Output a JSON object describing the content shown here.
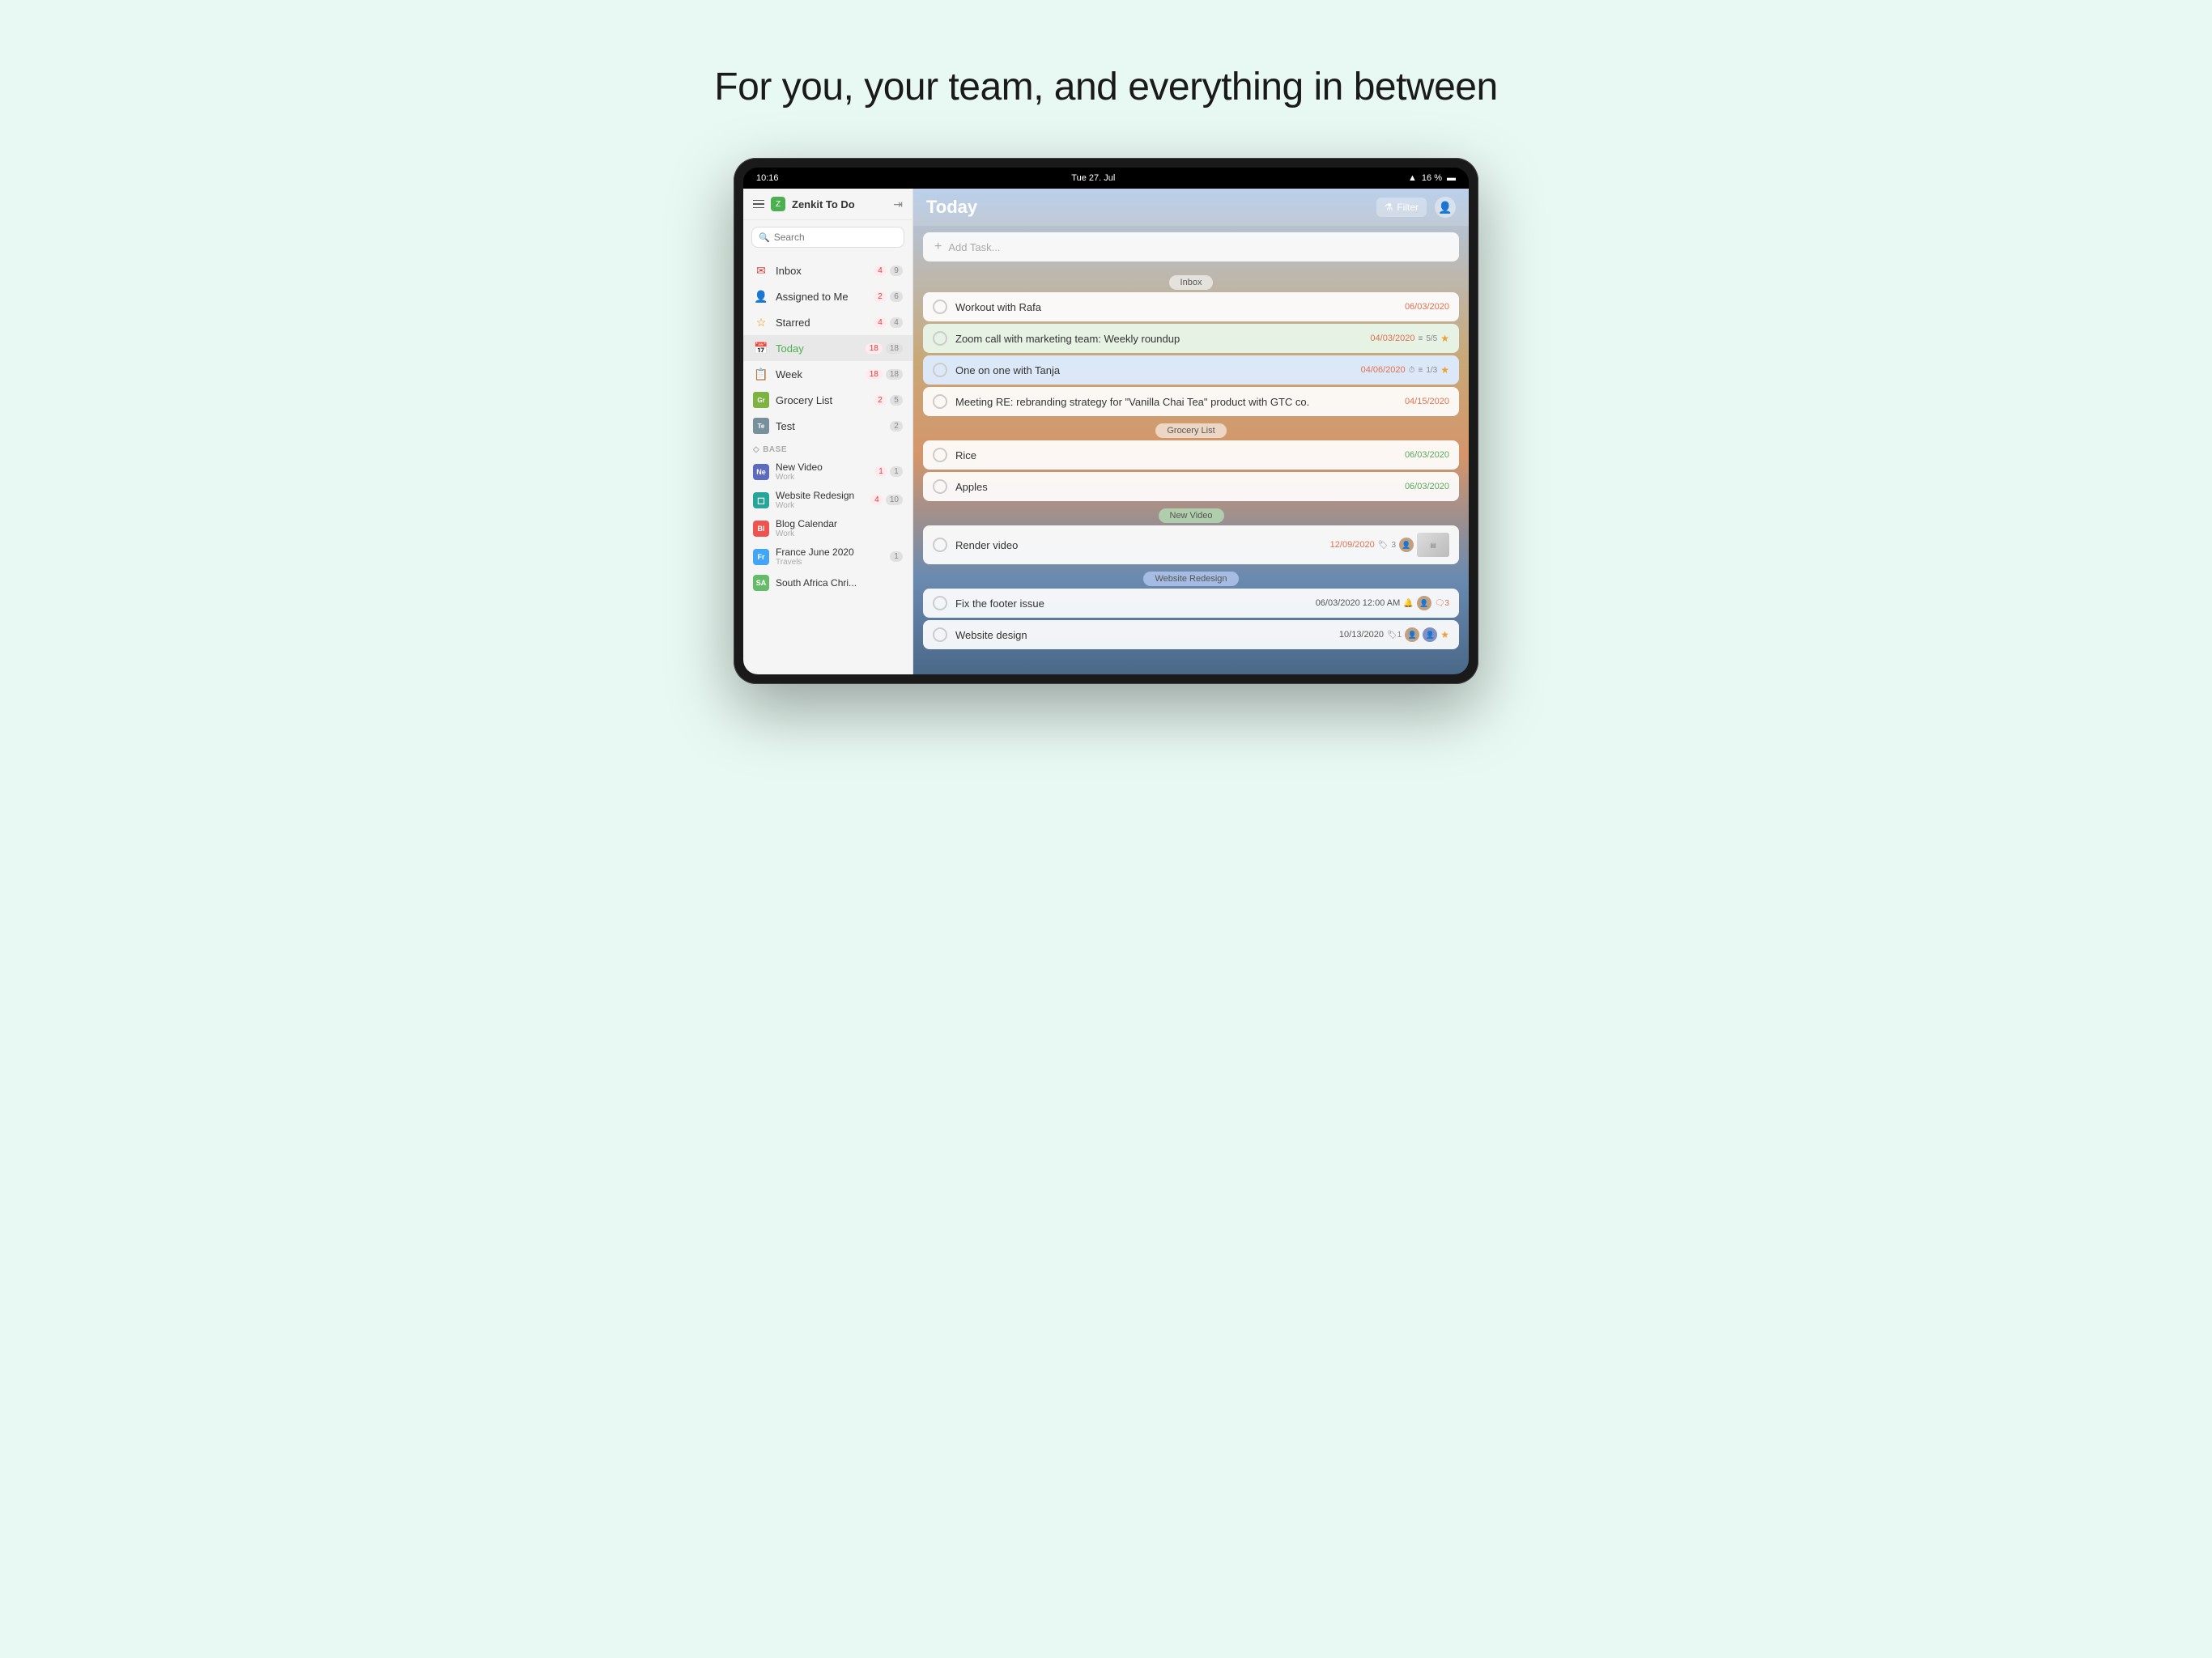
{
  "page": {
    "headline": "For you, your team, and everything in between"
  },
  "statusBar": {
    "time": "10:16",
    "date": "Tue 27. Jul",
    "battery": "16 %"
  },
  "sidebar": {
    "appName": "Zenkit To Do",
    "searchPlaceholder": "Search",
    "navItems": [
      {
        "id": "inbox",
        "icon": "✉",
        "iconColor": "#e53935",
        "label": "Inbox",
        "badge1": "4",
        "badge2": "9"
      },
      {
        "id": "assigned",
        "icon": "👤",
        "iconColor": "#ab47bc",
        "label": "Assigned to Me",
        "badge1": "2",
        "badge2": "6"
      },
      {
        "id": "starred",
        "icon": "☆",
        "iconColor": "#fb8c00",
        "label": "Starred",
        "badge1": "4",
        "badge2": "4"
      },
      {
        "id": "today",
        "icon": "📅",
        "iconColor": "#4CAF50",
        "label": "Today",
        "badge1": "18",
        "badge2": "18",
        "active": true
      },
      {
        "id": "week",
        "icon": "📋",
        "iconColor": "#fb8c00",
        "label": "Week",
        "badge1": "18",
        "badge2": "18"
      },
      {
        "id": "grocery",
        "icon": "Gr",
        "iconColor": "#7cb342",
        "label": "Grocery List",
        "badge1": "2",
        "badge2": "5"
      },
      {
        "id": "test",
        "icon": "Te",
        "iconColor": "#78909c",
        "label": "Test",
        "badge1": "2",
        "badge2": ""
      }
    ],
    "sectionHeader": "BASE",
    "projects": [
      {
        "id": "new-video",
        "abbr": "Ne",
        "color": "#5c6bc0",
        "name": "New Video",
        "sub": "Work",
        "badge1": "1",
        "badge2": "1"
      },
      {
        "id": "website",
        "abbr": "◻",
        "color": "#26a69a",
        "name": "Website Redesign",
        "sub": "Work",
        "badge1": "4",
        "badge2": "10",
        "isIcon": true
      },
      {
        "id": "blog",
        "abbr": "Bl",
        "color": "#ef5350",
        "name": "Blog Calendar",
        "sub": "Work",
        "badge1": "",
        "badge2": ""
      },
      {
        "id": "france",
        "abbr": "Fr",
        "color": "#42a5f5",
        "name": "France June 2020",
        "sub": "Travels",
        "badge1": "1",
        "badge2": ""
      },
      {
        "id": "south-africa",
        "abbr": "?",
        "color": "#66bb6a",
        "name": "South Africa Chri...",
        "sub": "",
        "badge1": "",
        "badge2": ""
      }
    ]
  },
  "main": {
    "title": "Today",
    "filterLabel": "Filter",
    "addTaskPlaceholder": "Add Task...",
    "sections": [
      {
        "id": "inbox",
        "label": "Inbox",
        "tasks": [
          {
            "id": "t1",
            "label": "Workout with Rafa",
            "date": "06/03/2020",
            "dateColor": "#e07050",
            "highlight": false
          },
          {
            "id": "t2",
            "label": "Zoom call with marketing team: Weekly roundup",
            "date": "04/03/2020",
            "dateColor": "#e07050",
            "subtasks": "5/5",
            "starred": true,
            "highlight": true
          },
          {
            "id": "t3",
            "label": "One on one with Tanja",
            "date": "04/06/2020",
            "dateColor": "#e07050",
            "subtasks": "1/3",
            "starred": true,
            "hasTimer": true,
            "highlight": false,
            "blueTint": true
          },
          {
            "id": "t4",
            "label": "Meeting RE: rebranding strategy for \"Vanilla Chai Tea\" product with GTC co.",
            "date": "04/15/2020",
            "dateColor": "#e07050",
            "highlight": false
          }
        ]
      },
      {
        "id": "grocery",
        "label": "Grocery List",
        "tasks": [
          {
            "id": "t5",
            "label": "Rice",
            "date": "06/03/2020",
            "dateColor": "#5aaa5a",
            "highlight": false
          },
          {
            "id": "t6",
            "label": "Apples",
            "date": "06/03/2020",
            "dateColor": "#5aaa5a",
            "highlight": false
          }
        ]
      },
      {
        "id": "new-video",
        "label": "New Video",
        "tasks": [
          {
            "id": "t7",
            "label": "Render video",
            "date": "12/09/2020",
            "dateColor": "#e07050",
            "tags": "3",
            "hasAvatar": true,
            "hasThumb": true,
            "highlight": false
          }
        ]
      },
      {
        "id": "website-redesign",
        "label": "Website Redesign",
        "tasks": [
          {
            "id": "t8",
            "label": "Fix the footer issue",
            "date": "06/03/2020 12:00 AM",
            "dateColor": "#555",
            "hasAvatarBell": true,
            "commentCount": "3",
            "highlight": false
          },
          {
            "id": "t9",
            "label": "Website design",
            "date": "10/13/2020",
            "dateColor": "#555",
            "tags": "1",
            "hasAvatars": true,
            "badge1": "1",
            "starred2": true,
            "highlight": false
          }
        ]
      }
    ]
  }
}
